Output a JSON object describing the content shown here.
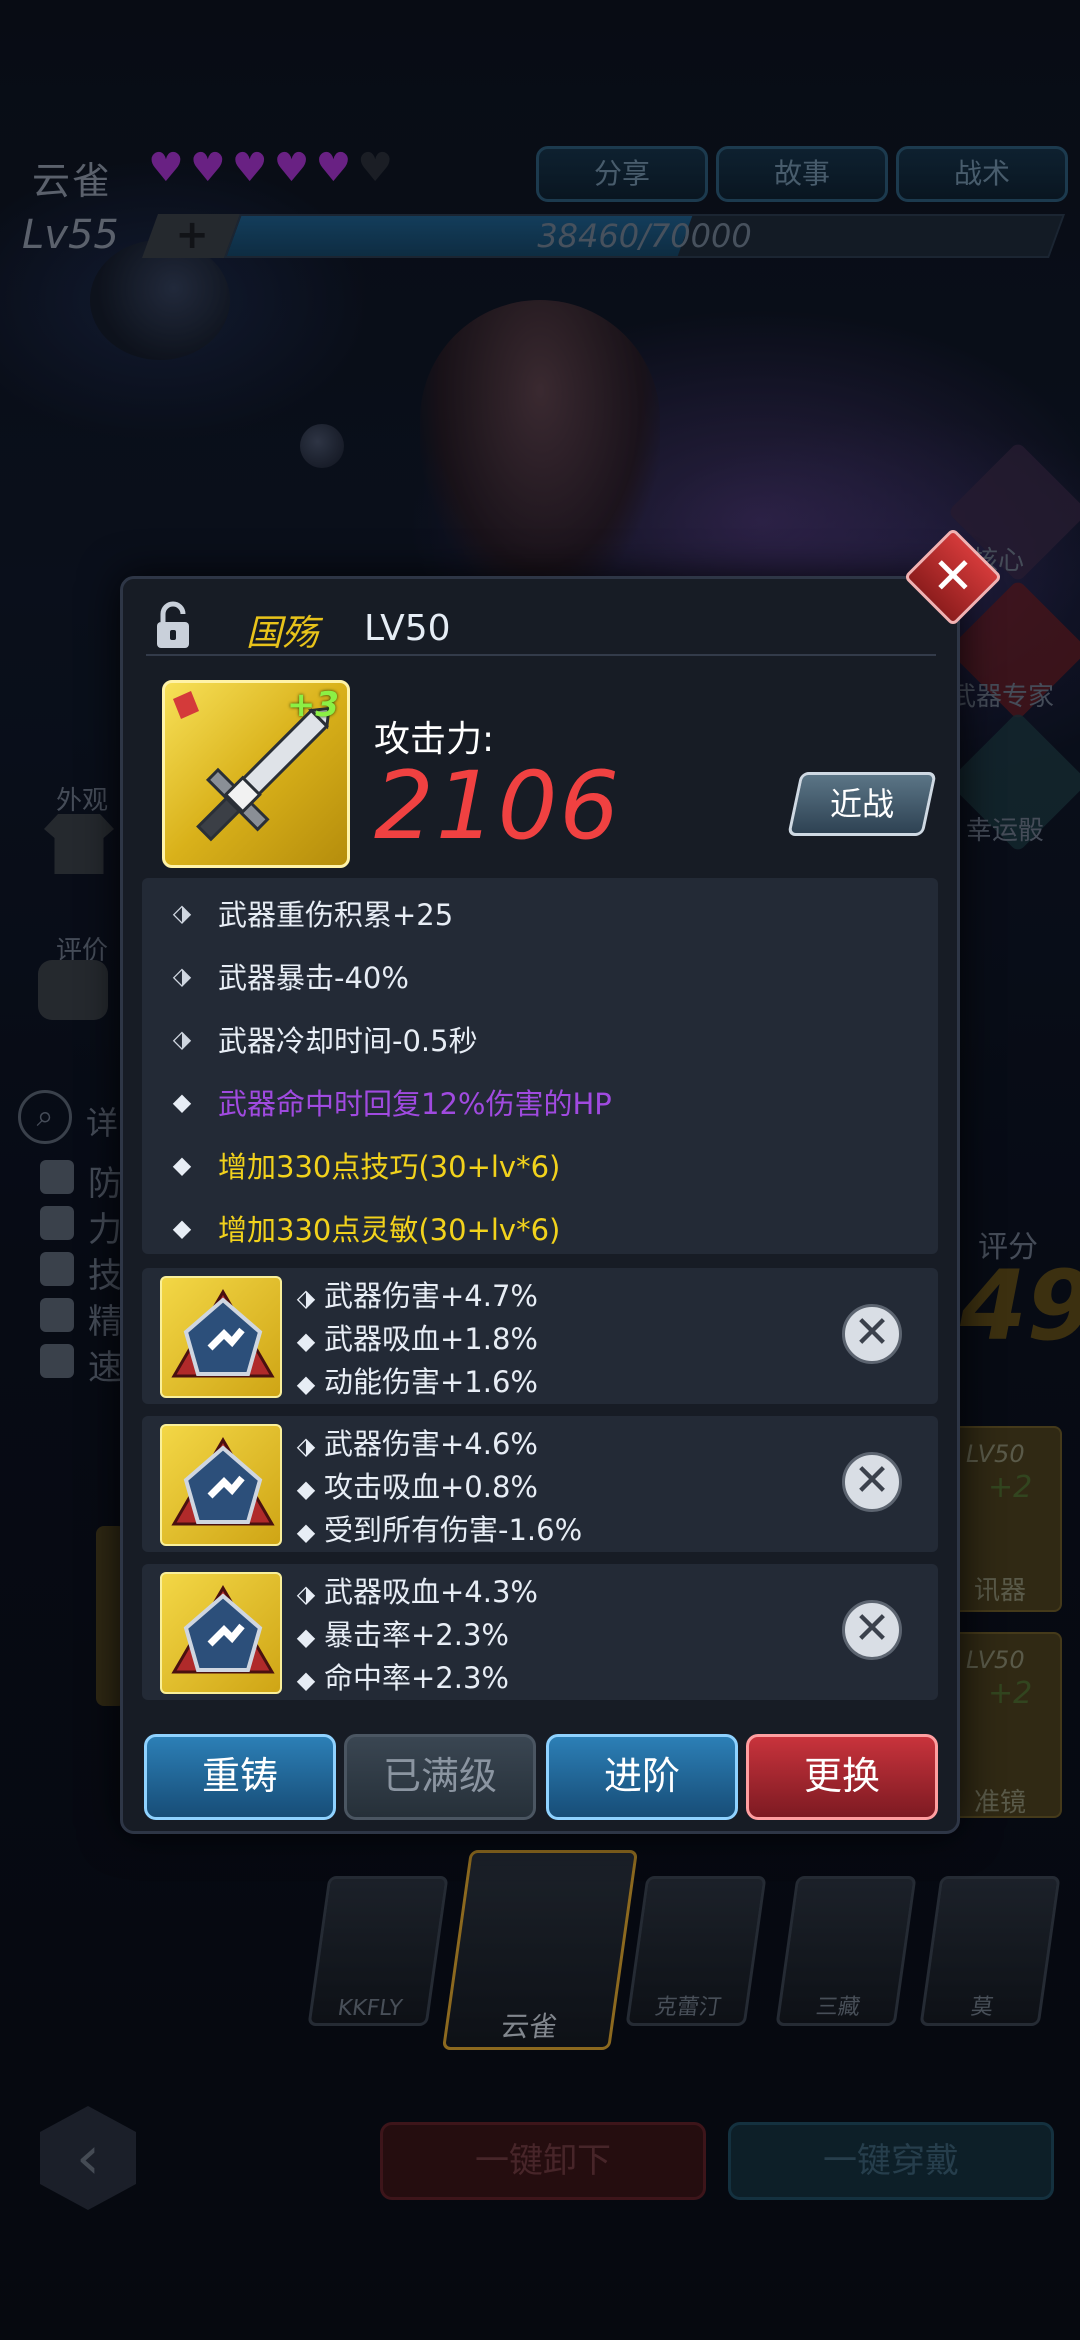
{
  "header": {
    "hero_name": "云雀",
    "hearts_filled": 5,
    "hearts_total": 6,
    "level": "Lv55",
    "level_plus": "+",
    "xp_text": "38460/70000",
    "xp_fraction": 0.549,
    "tabs": [
      "分享",
      "故事",
      "战术"
    ]
  },
  "sidebar": {
    "appearance_label": "外观",
    "review_label": "评价",
    "detail_label": "详",
    "attrs": [
      "防",
      "力",
      "技",
      "精",
      "速"
    ]
  },
  "right_panel": {
    "core_label": "核心",
    "weapon_expert_label": "武器专家",
    "lucky_dice_label": "幸运骰",
    "score_label": "评分",
    "score_value": "49",
    "item1_level": "LV50",
    "item1_plus": "+2",
    "item1_name": "讯器",
    "item2_level": "LV50",
    "item2_plus": "+2",
    "item2_name": "准镜"
  },
  "dialog": {
    "weapon_name": "国殇",
    "weapon_level": "LV50",
    "enhance": "+3",
    "attack_label": "攻击力:",
    "attack_value": "2106",
    "type_label": "近战",
    "stats": [
      {
        "text": "武器重伤积累+25",
        "kind": "base"
      },
      {
        "text": "武器暴击-40%",
        "kind": "base"
      },
      {
        "text": "武器冷却时间-0.5秒",
        "kind": "base"
      },
      {
        "text": "武器命中时回复12%伤害的HP",
        "kind": "purple"
      },
      {
        "text": "增加330点技巧(30+lv*6)",
        "kind": "yellow"
      },
      {
        "text": "增加330点灵敏(30+lv*6)",
        "kind": "yellow"
      }
    ],
    "slots": [
      {
        "lines": [
          "武器伤害+4.7%",
          "武器吸血+1.8%",
          "动能伤害+1.6%"
        ]
      },
      {
        "lines": [
          "武器伤害+4.6%",
          "攻击吸血+0.8%",
          "受到所有伤害-1.6%"
        ]
      },
      {
        "lines": [
          "武器吸血+4.3%",
          "暴击率+2.3%",
          "命中率+2.3%"
        ]
      }
    ],
    "actions": {
      "reforge": "重铸",
      "maxed": "已满级",
      "advance": "进阶",
      "replace": "更换"
    },
    "close_symbol": "✕"
  },
  "roster": {
    "characters": [
      "KKFLY",
      "云雀",
      "克蕾汀",
      "三藏",
      "莫"
    ]
  },
  "bottom": {
    "back_symbol": "‹",
    "unequip_all": "一键卸下",
    "equip_all": "一键穿戴"
  }
}
